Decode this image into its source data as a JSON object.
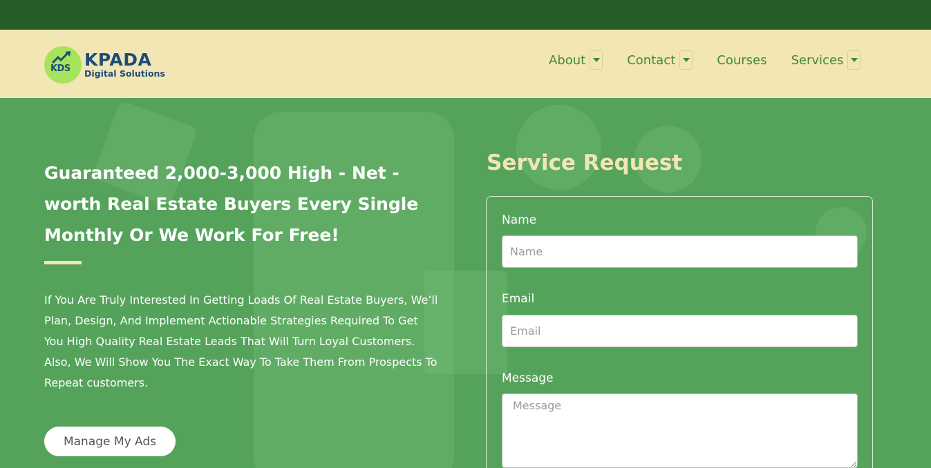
{
  "brand": {
    "badge_text": "KDS",
    "name": "KPADA",
    "subtitle": "Digital Solutions"
  },
  "nav": {
    "items": [
      {
        "label": "About",
        "has_dropdown": true
      },
      {
        "label": "Contact",
        "has_dropdown": true
      },
      {
        "label": "Courses",
        "has_dropdown": false
      },
      {
        "label": "Services",
        "has_dropdown": true
      }
    ]
  },
  "hero": {
    "headline": "Guaranteed 2,000-3,000 High - Net - worth Real Estate Buyers Every Single Monthly Or We Work For Free!",
    "paragraph": "If You Are Truly Interested In Getting Loads Of Real Estate Buyers, We’ll  Plan, Design, And Implement Actionable Strategies Required To Get You High Quality Real Estate Leads That Will Turn Loyal Customers. Also, We Will Show You The Exact Way To Take Them From Prospects To Repeat customers.",
    "cta_label": "Manage My Ads"
  },
  "form": {
    "title": "Service Request",
    "fields": {
      "name": {
        "label": "Name",
        "placeholder": "Name",
        "value": ""
      },
      "email": {
        "label": "Email",
        "placeholder": "Email",
        "value": ""
      },
      "message": {
        "label": "Message",
        "placeholder": "Message",
        "value": ""
      }
    }
  },
  "colors": {
    "topbar": "#265e2a",
    "header_bg": "#f2e6b4",
    "hero_bg": "#55a35b",
    "brand_blue": "#1d4c7c",
    "nav_green": "#3f8a3a",
    "accent_cream": "#f2e6b4"
  },
  "icons": {
    "dropdown": "chevron-down-icon",
    "logo_chart": "trend-arrow-icon"
  }
}
